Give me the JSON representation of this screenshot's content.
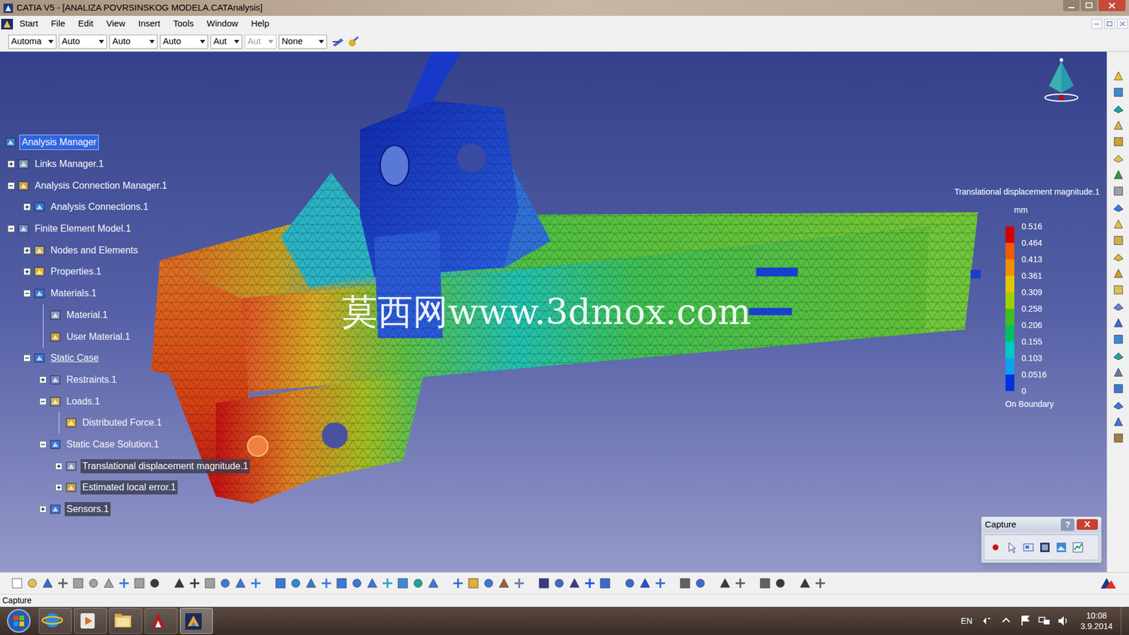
{
  "window": {
    "title": "CATIA V5 - [ANALIZA POVRSINSKOG MODELA.CATAnalysis]"
  },
  "menu": [
    "Start",
    "File",
    "Edit",
    "View",
    "Insert",
    "Tools",
    "Window",
    "Help"
  ],
  "toolbar": {
    "dropdowns": [
      {
        "value": "Automa",
        "disabled": false
      },
      {
        "value": "Auto",
        "disabled": false
      },
      {
        "value": "Auto",
        "disabled": false
      },
      {
        "value": "Auto",
        "disabled": false
      },
      {
        "value": "Aut",
        "disabled": false
      },
      {
        "value": "Aut",
        "disabled": true
      },
      {
        "value": "None",
        "disabled": false
      }
    ]
  },
  "tree": {
    "label": "Analysis Manager",
    "expander": "none",
    "selected": true,
    "highlighted": false,
    "underlined": false,
    "children": [
      {
        "label": "Links Manager.1",
        "expander": "collapsed",
        "selected": false,
        "highlighted": false,
        "underlined": false,
        "children": []
      },
      {
        "label": "Analysis Connection Manager.1",
        "expander": "expanded",
        "selected": false,
        "highlighted": false,
        "underlined": false,
        "children": [
          {
            "label": "Analysis Connections.1",
            "expander": "collapsed",
            "selected": false,
            "highlighted": false,
            "underlined": false,
            "children": []
          }
        ]
      },
      {
        "label": "Finite Element Model.1",
        "expander": "expanded",
        "selected": false,
        "highlighted": false,
        "underlined": false,
        "children": [
          {
            "label": "Nodes and Elements",
            "expander": "collapsed",
            "selected": false,
            "highlighted": false,
            "underlined": false,
            "children": []
          },
          {
            "label": "Properties.1",
            "expander": "collapsed",
            "selected": false,
            "highlighted": false,
            "underlined": false,
            "children": []
          },
          {
            "label": "Materials.1",
            "expander": "expanded",
            "selected": false,
            "highlighted": false,
            "underlined": false,
            "children": [
              {
                "label": "Material.1",
                "expander": "none",
                "selected": false,
                "highlighted": false,
                "underlined": false,
                "children": []
              },
              {
                "label": "User Material.1",
                "expander": "none",
                "selected": false,
                "highlighted": false,
                "underlined": false,
                "children": []
              }
            ]
          },
          {
            "label": "Static Case",
            "expander": "expanded",
            "selected": false,
            "highlighted": false,
            "underlined": true,
            "children": [
              {
                "label": "Restraints.1",
                "expander": "collapsed",
                "selected": false,
                "highlighted": false,
                "underlined": false,
                "children": []
              },
              {
                "label": "Loads.1",
                "expander": "expanded",
                "selected": false,
                "highlighted": false,
                "underlined": false,
                "children": [
                  {
                    "label": "Distributed Force.1",
                    "expander": "none",
                    "selected": false,
                    "highlighted": false,
                    "underlined": false,
                    "children": []
                  }
                ]
              },
              {
                "label": "Static Case Solution.1",
                "expander": "expanded",
                "selected": false,
                "highlighted": false,
                "underlined": false,
                "children": [
                  {
                    "label": "Translational displacement magnitude.1",
                    "expander": "collapsed",
                    "selected": false,
                    "highlighted": true,
                    "underlined": false,
                    "children": []
                  },
                  {
                    "label": "Estimated local error.1",
                    "expander": "collapsed",
                    "selected": false,
                    "highlighted": true,
                    "underlined": false,
                    "children": []
                  }
                ]
              },
              {
                "label": "Sensors.1",
                "expander": "collapsed",
                "selected": false,
                "highlighted": true,
                "underlined": false,
                "children": []
              }
            ]
          }
        ]
      }
    ]
  },
  "viewport": {
    "watermark": "莫西网www.3dmox.com"
  },
  "legend": {
    "title": "Translational displacement magnitude.1",
    "unit": "mm",
    "values": [
      "0.516",
      "0.464",
      "0.413",
      "0.361",
      "0.309",
      "0.258",
      "0.206",
      "0.155",
      "0.103",
      "0.0516",
      "0"
    ],
    "colors": [
      "#d40000",
      "#f05a00",
      "#f09000",
      "#e0c800",
      "#a0d000",
      "#40c020",
      "#00c060",
      "#00c8c8",
      "#10a0f0",
      "#0030e0"
    ],
    "footer": "On Boundary"
  },
  "capture_toolbar": {
    "title": "Capture",
    "help": "?"
  },
  "status_bar": "Capture",
  "taskbar": {
    "language": "EN",
    "time": "10:08",
    "date": "3.9.2014"
  }
}
